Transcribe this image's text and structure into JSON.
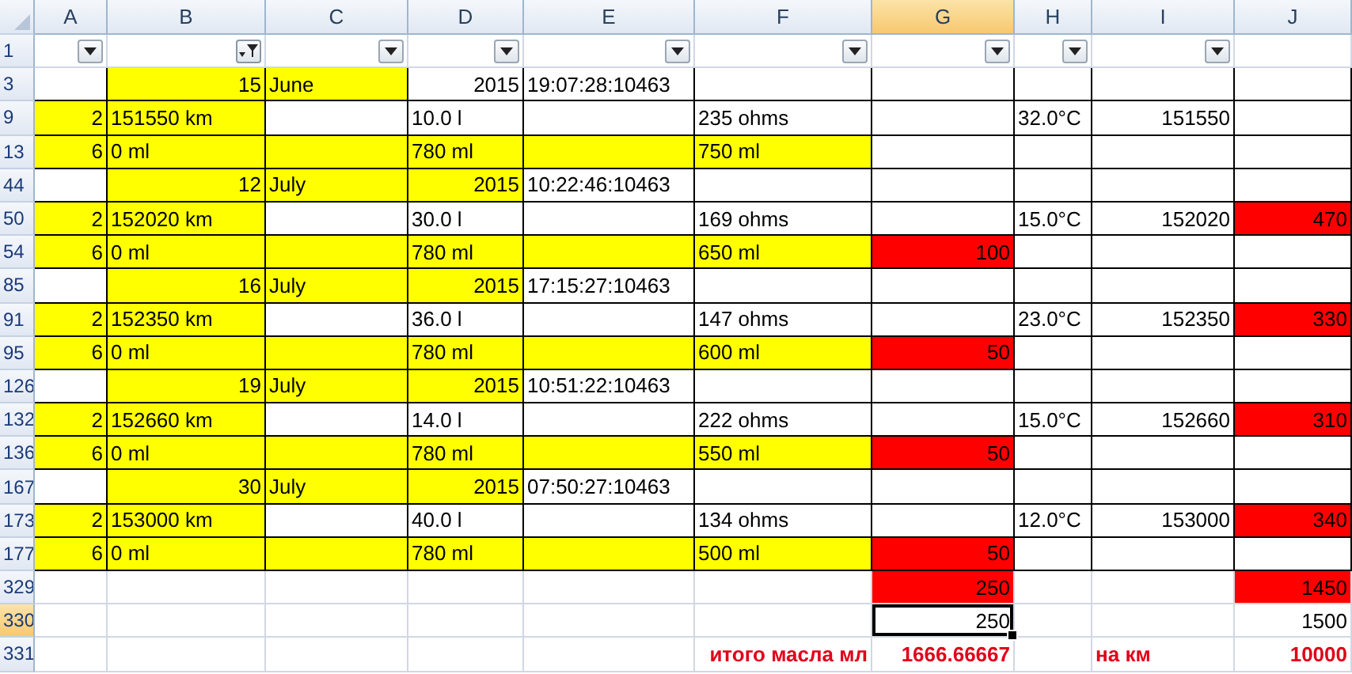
{
  "columns": [
    {
      "label": "A",
      "selected": false,
      "filter_button": true,
      "filtered": false
    },
    {
      "label": "B",
      "selected": false,
      "filter_button": true,
      "filtered": true
    },
    {
      "label": "C",
      "selected": false,
      "filter_button": true,
      "filtered": false
    },
    {
      "label": "D",
      "selected": false,
      "filter_button": true,
      "filtered": false
    },
    {
      "label": "E",
      "selected": false,
      "filter_button": true,
      "filtered": false
    },
    {
      "label": "F",
      "selected": false,
      "filter_button": true,
      "filtered": false
    },
    {
      "label": "G",
      "selected": true,
      "filter_button": true,
      "filtered": false
    },
    {
      "label": "H",
      "selected": false,
      "filter_button": true,
      "filtered": false
    },
    {
      "label": "I",
      "selected": false,
      "filter_button": true,
      "filtered": false
    },
    {
      "label": "J",
      "selected": false,
      "filter_button": false
    }
  ],
  "filter_row": {
    "label": "1",
    "selected": false
  },
  "rows": [
    {
      "label": "3",
      "selected": false,
      "kind": "table",
      "cells": [
        {},
        {
          "text": "15",
          "kind": "number",
          "color": "#ffff00"
        },
        {
          "text": "June",
          "kind": "text",
          "color": "#ffff00"
        },
        {
          "text": "2015",
          "kind": "number"
        },
        {
          "text": "19:07:28:10463",
          "kind": "text"
        },
        {},
        {},
        {},
        {},
        {}
      ]
    },
    {
      "label": "9",
      "selected": false,
      "kind": "table",
      "cells": [
        {
          "text": "2",
          "kind": "number",
          "color": "#ffff00"
        },
        {
          "text": "151550 km",
          "kind": "text",
          "color": "#ffff00"
        },
        {},
        {
          "text": "10.0 l",
          "kind": "text"
        },
        {},
        {
          "text": "235 ohms",
          "kind": "text"
        },
        {},
        {
          "text": "32.0°C",
          "kind": "text"
        },
        {
          "text": "151550",
          "kind": "number"
        },
        {}
      ]
    },
    {
      "label": "13",
      "selected": false,
      "kind": "table",
      "cells": [
        {
          "text": "6",
          "kind": "number",
          "color": "#ffff00"
        },
        {
          "text": "0 ml",
          "kind": "text",
          "color": "#ffff00"
        },
        {
          "color": "#ffff00"
        },
        {
          "text": "780 ml",
          "kind": "text",
          "color": "#ffff00"
        },
        {
          "color": "#ffff00"
        },
        {
          "text": "750 ml",
          "kind": "text",
          "color": "#ffff00"
        },
        {},
        {},
        {},
        {}
      ]
    },
    {
      "label": "44",
      "selected": false,
      "kind": "table",
      "cells": [
        {},
        {
          "text": "12",
          "kind": "number",
          "color": "#ffff00"
        },
        {
          "text": "July",
          "kind": "text",
          "color": "#ffff00"
        },
        {
          "text": "2015",
          "kind": "number",
          "color": "#ffff00"
        },
        {
          "text": "10:22:46:10463",
          "kind": "text"
        },
        {},
        {},
        {},
        {},
        {}
      ]
    },
    {
      "label": "50",
      "selected": false,
      "kind": "table",
      "cells": [
        {
          "text": "2",
          "kind": "number",
          "color": "#ffff00"
        },
        {
          "text": "152020 km",
          "kind": "text",
          "color": "#ffff00"
        },
        {},
        {
          "text": "30.0 l",
          "kind": "text"
        },
        {},
        {
          "text": "169 ohms",
          "kind": "text"
        },
        {},
        {
          "text": "15.0°C",
          "kind": "text"
        },
        {
          "text": "152020",
          "kind": "number"
        },
        {
          "text": "470",
          "kind": "number",
          "color": "#ff0000"
        }
      ]
    },
    {
      "label": "54",
      "selected": false,
      "kind": "table",
      "cells": [
        {
          "text": "6",
          "kind": "number",
          "color": "#ffff00"
        },
        {
          "text": "0 ml",
          "kind": "text",
          "color": "#ffff00"
        },
        {
          "color": "#ffff00"
        },
        {
          "text": "780 ml",
          "kind": "text",
          "color": "#ffff00"
        },
        {
          "color": "#ffff00"
        },
        {
          "text": "650 ml",
          "kind": "text",
          "color": "#ffff00"
        },
        {
          "text": "100",
          "kind": "number",
          "color": "#ff0000"
        },
        {},
        {},
        {}
      ]
    },
    {
      "label": "85",
      "selected": false,
      "kind": "table",
      "cells": [
        {},
        {
          "text": "16",
          "kind": "number",
          "color": "#ffff00"
        },
        {
          "text": "July",
          "kind": "text",
          "color": "#ffff00"
        },
        {
          "text": "2015",
          "kind": "number",
          "color": "#ffff00"
        },
        {
          "text": "17:15:27:10463",
          "kind": "text"
        },
        {},
        {},
        {},
        {},
        {}
      ]
    },
    {
      "label": "91",
      "selected": false,
      "kind": "table",
      "cells": [
        {
          "text": "2",
          "kind": "number",
          "color": "#ffff00"
        },
        {
          "text": "152350 km",
          "kind": "text",
          "color": "#ffff00"
        },
        {},
        {
          "text": "36.0 l",
          "kind": "text"
        },
        {},
        {
          "text": "147 ohms",
          "kind": "text"
        },
        {},
        {
          "text": "23.0°C",
          "kind": "text"
        },
        {
          "text": "152350",
          "kind": "number"
        },
        {
          "text": "330",
          "kind": "number",
          "color": "#ff0000"
        }
      ]
    },
    {
      "label": "95",
      "selected": false,
      "kind": "table",
      "cells": [
        {
          "text": "6",
          "kind": "number",
          "color": "#ffff00"
        },
        {
          "text": "0 ml",
          "kind": "text",
          "color": "#ffff00"
        },
        {
          "color": "#ffff00"
        },
        {
          "text": "780 ml",
          "kind": "text",
          "color": "#ffff00"
        },
        {
          "color": "#ffff00"
        },
        {
          "text": "600 ml",
          "kind": "text",
          "color": "#ffff00"
        },
        {
          "text": "50",
          "kind": "number",
          "color": "#ff0000"
        },
        {},
        {},
        {}
      ]
    },
    {
      "label": "126",
      "selected": false,
      "kind": "table",
      "cells": [
        {},
        {
          "text": "19",
          "kind": "number",
          "color": "#ffff00"
        },
        {
          "text": "July",
          "kind": "text",
          "color": "#ffff00"
        },
        {
          "text": "2015",
          "kind": "number",
          "color": "#ffff00"
        },
        {
          "text": "10:51:22:10463",
          "kind": "text"
        },
        {},
        {},
        {},
        {},
        {}
      ]
    },
    {
      "label": "132",
      "selected": false,
      "kind": "table",
      "cells": [
        {
          "text": "2",
          "kind": "number",
          "color": "#ffff00"
        },
        {
          "text": "152660 km",
          "kind": "text",
          "color": "#ffff00"
        },
        {},
        {
          "text": "14.0 l",
          "kind": "text"
        },
        {},
        {
          "text": "222 ohms",
          "kind": "text"
        },
        {},
        {
          "text": "15.0°C",
          "kind": "text"
        },
        {
          "text": "152660",
          "kind": "number"
        },
        {
          "text": "310",
          "kind": "number",
          "color": "#ff0000"
        }
      ]
    },
    {
      "label": "136",
      "selected": false,
      "kind": "table",
      "cells": [
        {
          "text": "6",
          "kind": "number",
          "color": "#ffff00"
        },
        {
          "text": "0 ml",
          "kind": "text",
          "color": "#ffff00"
        },
        {
          "color": "#ffff00"
        },
        {
          "text": "780 ml",
          "kind": "text",
          "color": "#ffff00"
        },
        {
          "color": "#ffff00"
        },
        {
          "text": "550 ml",
          "kind": "text",
          "color": "#ffff00"
        },
        {
          "text": "50",
          "kind": "number",
          "color": "#ff0000"
        },
        {},
        {},
        {}
      ]
    },
    {
      "label": "167",
      "selected": false,
      "kind": "table",
      "cells": [
        {},
        {
          "text": "30",
          "kind": "number",
          "color": "#ffff00"
        },
        {
          "text": "July",
          "kind": "text",
          "color": "#ffff00"
        },
        {
          "text": "2015",
          "kind": "number",
          "color": "#ffff00"
        },
        {
          "text": "07:50:27:10463",
          "kind": "text"
        },
        {},
        {},
        {},
        {},
        {}
      ]
    },
    {
      "label": "173",
      "selected": false,
      "kind": "table",
      "cells": [
        {
          "text": "2",
          "kind": "number",
          "color": "#ffff00"
        },
        {
          "text": "153000 km",
          "kind": "text",
          "color": "#ffff00"
        },
        {},
        {
          "text": "40.0 l",
          "kind": "text"
        },
        {},
        {
          "text": "134 ohms",
          "kind": "text"
        },
        {},
        {
          "text": "12.0°C",
          "kind": "text"
        },
        {
          "text": "153000",
          "kind": "number"
        },
        {
          "text": "340",
          "kind": "number",
          "color": "#ff0000"
        }
      ]
    },
    {
      "label": "177",
      "selected": false,
      "kind": "table",
      "cells": [
        {
          "text": "6",
          "kind": "number",
          "color": "#ffff00"
        },
        {
          "text": "0 ml",
          "kind": "text",
          "color": "#ffff00"
        },
        {
          "color": "#ffff00"
        },
        {
          "text": "780 ml",
          "kind": "text",
          "color": "#ffff00"
        },
        {
          "color": "#ffff00"
        },
        {
          "text": "500 ml",
          "kind": "text",
          "color": "#ffff00"
        },
        {
          "text": "50",
          "kind": "number",
          "color": "#ff0000"
        },
        {},
        {},
        {}
      ]
    },
    {
      "label": "329",
      "selected": false,
      "kind": "plain",
      "cells": [
        {},
        {},
        {},
        {},
        {},
        {},
        {
          "text": "250",
          "kind": "number",
          "color": "#ff0000"
        },
        {},
        {},
        {
          "text": "1450",
          "kind": "number",
          "color": "#ff0000"
        }
      ]
    },
    {
      "label": "330",
      "selected": true,
      "kind": "plain",
      "cells": [
        {},
        {},
        {},
        {},
        {},
        {},
        {
          "text": "250",
          "kind": "number",
          "selected": true
        },
        {},
        {},
        {
          "text": "1500",
          "kind": "number"
        }
      ]
    },
    {
      "label": "331",
      "selected": false,
      "kind": "plain",
      "cells": [
        {},
        {},
        {},
        {},
        {},
        {
          "text": "итого масла мл",
          "kind": "total"
        },
        {
          "text": "1666.66667",
          "kind": "total"
        },
        {},
        {
          "text": "на км",
          "kind": "total-left"
        },
        {
          "text": "10000",
          "kind": "total"
        }
      ]
    }
  ]
}
